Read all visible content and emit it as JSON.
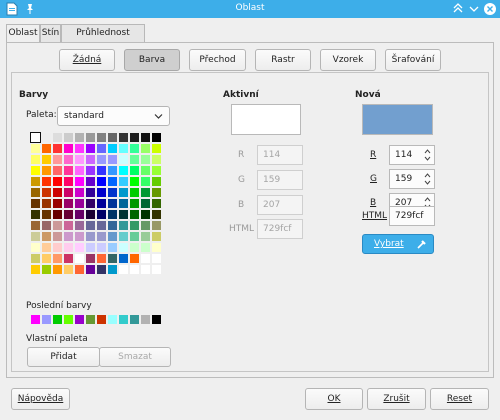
{
  "window": {
    "title": "Oblast"
  },
  "tabs": [
    {
      "label": "Oblast"
    },
    {
      "label": "Stín"
    },
    {
      "label": "Průhlednost"
    }
  ],
  "fill_buttons": [
    {
      "label": "Žádná"
    },
    {
      "label": "Barva"
    },
    {
      "label": "Přechod"
    },
    {
      "label": "Rastr"
    },
    {
      "label": "Vzorek"
    },
    {
      "label": "Šrafování"
    }
  ],
  "colors_section": {
    "heading": "Barvy",
    "palette_label": "Paleta:",
    "palette_value": "standard",
    "recent_heading": "Poslední barvy",
    "custom_heading": "Vlastní paleta",
    "add_label": "Přidat",
    "delete_label": "Smazat"
  },
  "palette_colors": [
    "#ffffff",
    "#eeeeee",
    "#dddddd",
    "#cccccc",
    "#b2b2b2",
    "#999999",
    "#808080",
    "#666666",
    "#333333",
    "#1c1c1c",
    "#111111",
    "#000000",
    "#ffff99",
    "#ff6600",
    "#ff3333",
    "#ff00cc",
    "#ff33ff",
    "#9900ff",
    "#6666ff",
    "#00ccff",
    "#66ffff",
    "#33ff99",
    "#99ff66",
    "#ccff00",
    "#ffff66",
    "#ffcc00",
    "#ff9999",
    "#ff66cc",
    "#ff99ff",
    "#cc66ff",
    "#9999ff",
    "#9999ff",
    "#ccffff",
    "#66ff99",
    "#99ff99",
    "#ccff66",
    "#ffff00",
    "#ff9900",
    "#ff6666",
    "#ff3399",
    "#ff66ff",
    "#9933ff",
    "#3333ff",
    "#3399ff",
    "#00ffff",
    "#00ff66",
    "#66ff66",
    "#99ff33",
    "#cc9900",
    "#ff3300",
    "#ff0000",
    "#ff0066",
    "#ff00ff",
    "#6600cc",
    "#0000ff",
    "#0066ff",
    "#33ccff",
    "#00ff00",
    "#33ff66",
    "#66cc00",
    "#996600",
    "#cc3300",
    "#cc0000",
    "#cc0066",
    "#cc00cc",
    "#330099",
    "#0000cc",
    "#0033cc",
    "#0099cc",
    "#00cc00",
    "#009933",
    "#669900",
    "#663300",
    "#993300",
    "#990000",
    "#990066",
    "#990099",
    "#330066",
    "#000099",
    "#003399",
    "#006699",
    "#009900",
    "#006633",
    "#336600",
    "#333300",
    "#663300",
    "#660000",
    "#660033",
    "#660066",
    "#1a0033",
    "#000066",
    "#003366",
    "#003333",
    "#006600",
    "#003300",
    "#333300",
    "#996633",
    "#996666",
    "#cc9999",
    "#cc6699",
    "#996699",
    "#666699",
    "#666699",
    "#336699",
    "#339999",
    "#339966",
    "#669966",
    "#999966",
    "#cccc99",
    "#cc9966",
    "#cc9999",
    "#cc99cc",
    "#cc99cc",
    "#9999cc",
    "#9999cc",
    "#6699cc",
    "#66cccc",
    "#66cc99",
    "#99cc99",
    "#cccc66",
    "#ffffcc",
    "#ffcc99",
    "#ffcccc",
    "#ffccee",
    "#ffccff",
    "#ccccff",
    "#ccccff",
    "#99ccff",
    "#ccffff",
    "#ccffcc",
    "#ccffcc",
    "#ffffcc",
    "#cccc66",
    "#ffcc66",
    "#ff9966",
    "#cc3366",
    "#ffffff",
    "#993366",
    "#ff6633",
    "#336666",
    "#0066cc",
    "#ff6600",
    "#ffffff",
    "#ffffff",
    "#ffcc00",
    "#99cc00",
    "#ff9900",
    "#ffcc66",
    "#ff6633",
    "#660099",
    "#333366",
    "#0099cc",
    "#ffffff",
    "#ffffff",
    "#ffffff",
    "#ffffff"
  ],
  "recent_colors": [
    "#ff00ff",
    "#9999ff",
    "#00cc00",
    "#66ff00",
    "#9900cc",
    "#669933",
    "#cc3300",
    "#99ffff",
    "#33cccc",
    "#339999",
    "#b2b2b2",
    "#000000"
  ],
  "active": {
    "heading": "Aktivní",
    "color": "#ffffff",
    "r_label": "R",
    "r_value": "114",
    "g_label": "G",
    "g_value": "159",
    "b_label": "B",
    "b_value": "207",
    "html_label": "HTML",
    "html_value": "729fcf"
  },
  "new": {
    "heading": "Nová",
    "color": "#729fcf",
    "r_label": "R",
    "r_value": "114",
    "g_label": "G",
    "g_value": "159",
    "b_label": "B",
    "b_value": "207",
    "html_label": "HTML",
    "html_value": "729fcf",
    "pick_label": "Vybrat"
  },
  "footer": {
    "help_label": "Nápověda",
    "ok_label": "OK",
    "cancel_label": "Zrušit",
    "reset_label": "Reset"
  },
  "accent_color": "#3daee9"
}
